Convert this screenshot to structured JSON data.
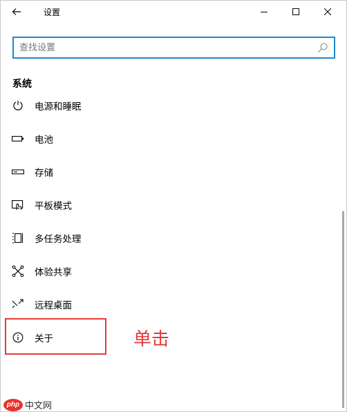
{
  "window": {
    "title": "设置"
  },
  "search": {
    "placeholder": "查找设置"
  },
  "section": {
    "title": "系统"
  },
  "nav": {
    "items": [
      {
        "label": "电源和睡眠",
        "icon": "power-icon"
      },
      {
        "label": "电池",
        "icon": "battery-icon"
      },
      {
        "label": "存储",
        "icon": "storage-icon"
      },
      {
        "label": "平板模式",
        "icon": "tablet-mode-icon"
      },
      {
        "label": "多任务处理",
        "icon": "multitasking-icon"
      },
      {
        "label": "体验共享",
        "icon": "shared-experiences-icon"
      },
      {
        "label": "远程桌面",
        "icon": "remote-desktop-icon"
      },
      {
        "label": "关于",
        "icon": "info-icon"
      }
    ]
  },
  "annotation": {
    "text": "单击",
    "color": "#e23a3a"
  },
  "watermark": {
    "logo": "php",
    "text": "中文网"
  },
  "colors": {
    "accent": "#1f86d1",
    "highlight": "#e23a3a"
  }
}
